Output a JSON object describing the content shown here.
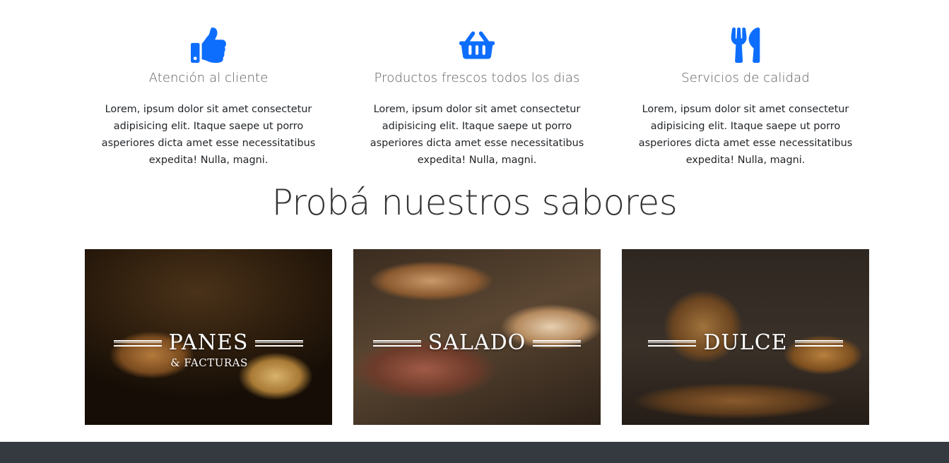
{
  "features": [
    {
      "icon": "thumbs-up-icon",
      "title": "Atención al cliente",
      "text": "Lorem, ipsum dolor sit amet consectetur adipisicing elit. Itaque saepe ut porro asperiores dicta amet esse necessitatibus expedita! Nulla, magni."
    },
    {
      "icon": "shopping-basket-icon",
      "title": "Productos frescos todos los dias",
      "text": "Lorem, ipsum dolor sit amet consectetur adipisicing elit. Itaque saepe ut porro asperiores dicta amet esse necessitatibus expedita! Nulla, magni."
    },
    {
      "icon": "fork-knife-icon",
      "title": "Servicios de calidad",
      "text": "Lorem, ipsum dolor sit amet consectetur adipisicing elit. Itaque saepe ut porro asperiores dicta amet esse necessitatibus expedita! Nulla, magni."
    }
  ],
  "section": {
    "title": "Probá nuestros sabores"
  },
  "cards": [
    {
      "title": "PANES",
      "subtitle": "& FACTURAS"
    },
    {
      "title": "SALADO"
    },
    {
      "title": "DULCE"
    }
  ],
  "colors": {
    "accent": "#0d6efd",
    "footer": "#343a40"
  }
}
